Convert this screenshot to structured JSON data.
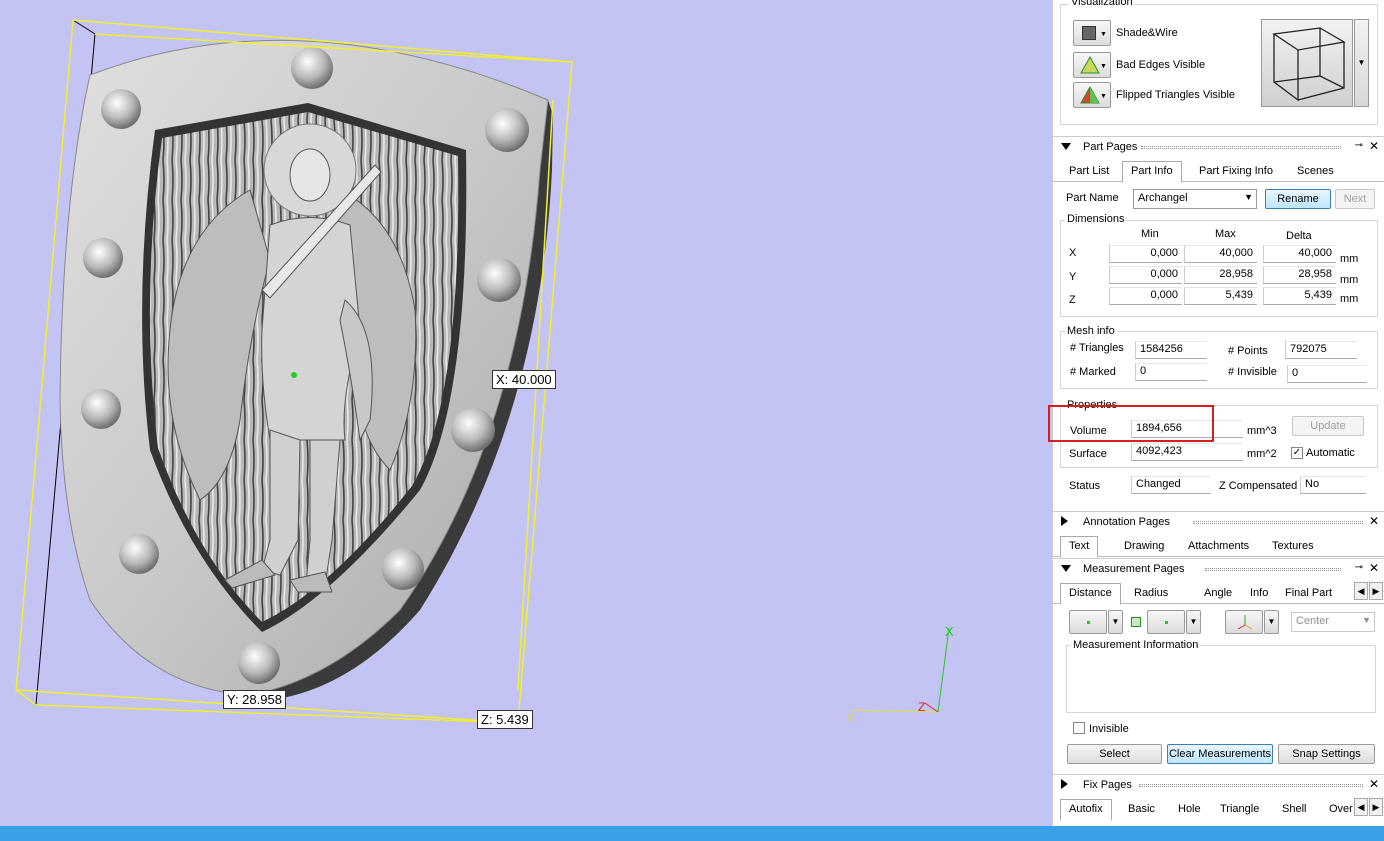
{
  "viewport": {
    "dim_x": "X: 40.000",
    "dim_y": "Y: 28.958",
    "dim_z": "Z: 5.439",
    "axis_x": "X",
    "axis_y": "Y",
    "axis_z": "Z"
  },
  "visualization": {
    "title": "Visualization",
    "items": [
      "Shade&Wire",
      "Bad Edges Visible",
      "Flipped Triangles Visible"
    ]
  },
  "part_pages": {
    "title": "Part Pages",
    "tabs": [
      "Part List",
      "Part Info",
      "Part Fixing Info",
      "Scenes"
    ],
    "active_tab": "Part Info",
    "part_name_label": "Part Name",
    "part_name_value": "Archangel",
    "rename_label": "Rename",
    "next_label": "Next",
    "dimensions": {
      "title": "Dimensions",
      "headers": [
        "Min",
        "Max",
        "Delta"
      ],
      "rows": [
        {
          "axis": "X",
          "min": "0,000",
          "max": "40,000",
          "delta": "40,000",
          "unit": "mm"
        },
        {
          "axis": "Y",
          "min": "0,000",
          "max": "28,958",
          "delta": "28,958",
          "unit": "mm"
        },
        {
          "axis": "Z",
          "min": "0,000",
          "max": "5,439",
          "delta": "5,439",
          "unit": "mm"
        }
      ]
    },
    "mesh_info": {
      "title": "Mesh info",
      "triangles_label": "# Triangles",
      "triangles_value": "1584256",
      "points_label": "# Points",
      "points_value": "792075",
      "marked_label": "# Marked",
      "marked_value": "0",
      "invisible_label": "# Invisible",
      "invisible_value": "0"
    },
    "properties": {
      "title": "Properties",
      "volume_label": "Volume",
      "volume_value": "1894,656",
      "volume_unit": "mm^3",
      "surface_label": "Surface",
      "surface_value": "4092,423",
      "surface_unit": "mm^2",
      "update_label": "Update",
      "automatic_label": "Automatic",
      "automatic_checked": true
    },
    "status_label": "Status",
    "status_value": "Changed",
    "z_comp_label": "Z Compensated",
    "z_comp_value": "No"
  },
  "annotation_pages": {
    "title": "Annotation Pages",
    "tabs": [
      "Text",
      "Drawing",
      "Attachments",
      "Textures"
    ],
    "active_tab": "Text"
  },
  "measurement_pages": {
    "title": "Measurement Pages",
    "tabs": [
      "Distance",
      "Radius",
      "Angle",
      "Info",
      "Final Part"
    ],
    "active_tab": "Distance",
    "center_value": "Center",
    "info_title": "Measurement Information",
    "invisible_label": "Invisible",
    "select_label": "Select",
    "clear_label": "Clear Measurements",
    "snap_label": "Snap Settings"
  },
  "fix_pages": {
    "title": "Fix Pages",
    "tabs": [
      "Autofix",
      "Basic",
      "Hole",
      "Triangle",
      "Shell",
      "Over"
    ],
    "active_tab": "Autofix"
  },
  "colors": {
    "viewport_bg": "#c4c4f4",
    "bounding_box": "#f0f030",
    "highlight_box": "#d42020",
    "taskbar": "#3aa0e8"
  }
}
